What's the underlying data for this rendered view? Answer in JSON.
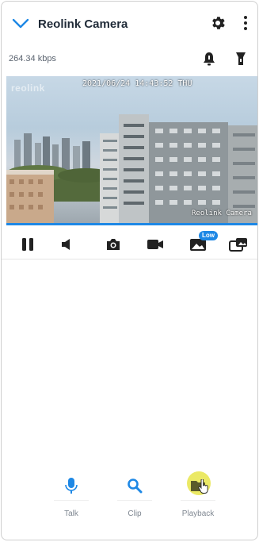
{
  "header": {
    "title": "Reolink Camera",
    "bitrate": "264.34 kbps"
  },
  "video": {
    "timestamp": "2021/06/24 14:43:52 THU",
    "brand_overlay": "Reolink Camera",
    "logo_text": "reolink"
  },
  "controls": {
    "items": [
      "pause-icon",
      "speaker-icon",
      "snapshot-icon",
      "record-icon",
      "quality-icon",
      "multi-view-icon"
    ],
    "quality_badge": "Low"
  },
  "actions": [
    {
      "label": "Talk",
      "icon": "microphone-icon"
    },
    {
      "label": "Clip",
      "icon": "search-icon"
    },
    {
      "label": "Playback",
      "icon": "playback-icon"
    }
  ],
  "colors": {
    "accent": "#1e88e5",
    "highlight": "#e8e54a",
    "title": "#1f2a37",
    "muted": "#808892"
  }
}
